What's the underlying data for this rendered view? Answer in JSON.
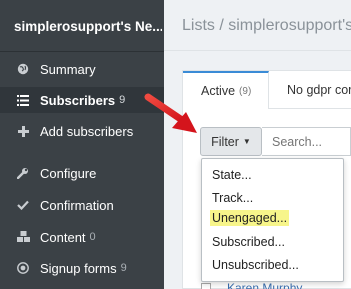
{
  "sidebar": {
    "title": "simplerosupport's Ne...",
    "items": [
      {
        "label": "Summary",
        "icon": "globe-icon",
        "count": ""
      },
      {
        "label": "Subscribers",
        "icon": "list-icon",
        "count": "9"
      },
      {
        "label": "Add subscribers",
        "icon": "plus-icon",
        "count": ""
      },
      {
        "label": "Configure",
        "icon": "wrench-icon",
        "count": ""
      },
      {
        "label": "Confirmation",
        "icon": "check-icon",
        "count": ""
      },
      {
        "label": "Content",
        "icon": "cubes-icon",
        "count": "0"
      },
      {
        "label": "Signup forms",
        "icon": "target-icon",
        "count": "9"
      }
    ]
  },
  "main": {
    "breadcrumb": "Lists / simplerosupport's",
    "tabs": [
      {
        "label": "Active",
        "count": "(9)"
      },
      {
        "label": "No gdpr cor",
        "count": ""
      }
    ],
    "filter_label": "Filter",
    "search_placeholder": "Search...",
    "filter_menu": [
      "State...",
      "Track...",
      "Unengaged...",
      "Subscribed...",
      "Unsubscribed..."
    ],
    "highlighted_item": "Unengaged...",
    "partial_row_name": "Karen Murphy"
  },
  "colors": {
    "sidebar_bg": "#3b4146",
    "accent": "#3a8bd6",
    "highlight": "#f7f58a",
    "arrow": "#e8231f"
  }
}
